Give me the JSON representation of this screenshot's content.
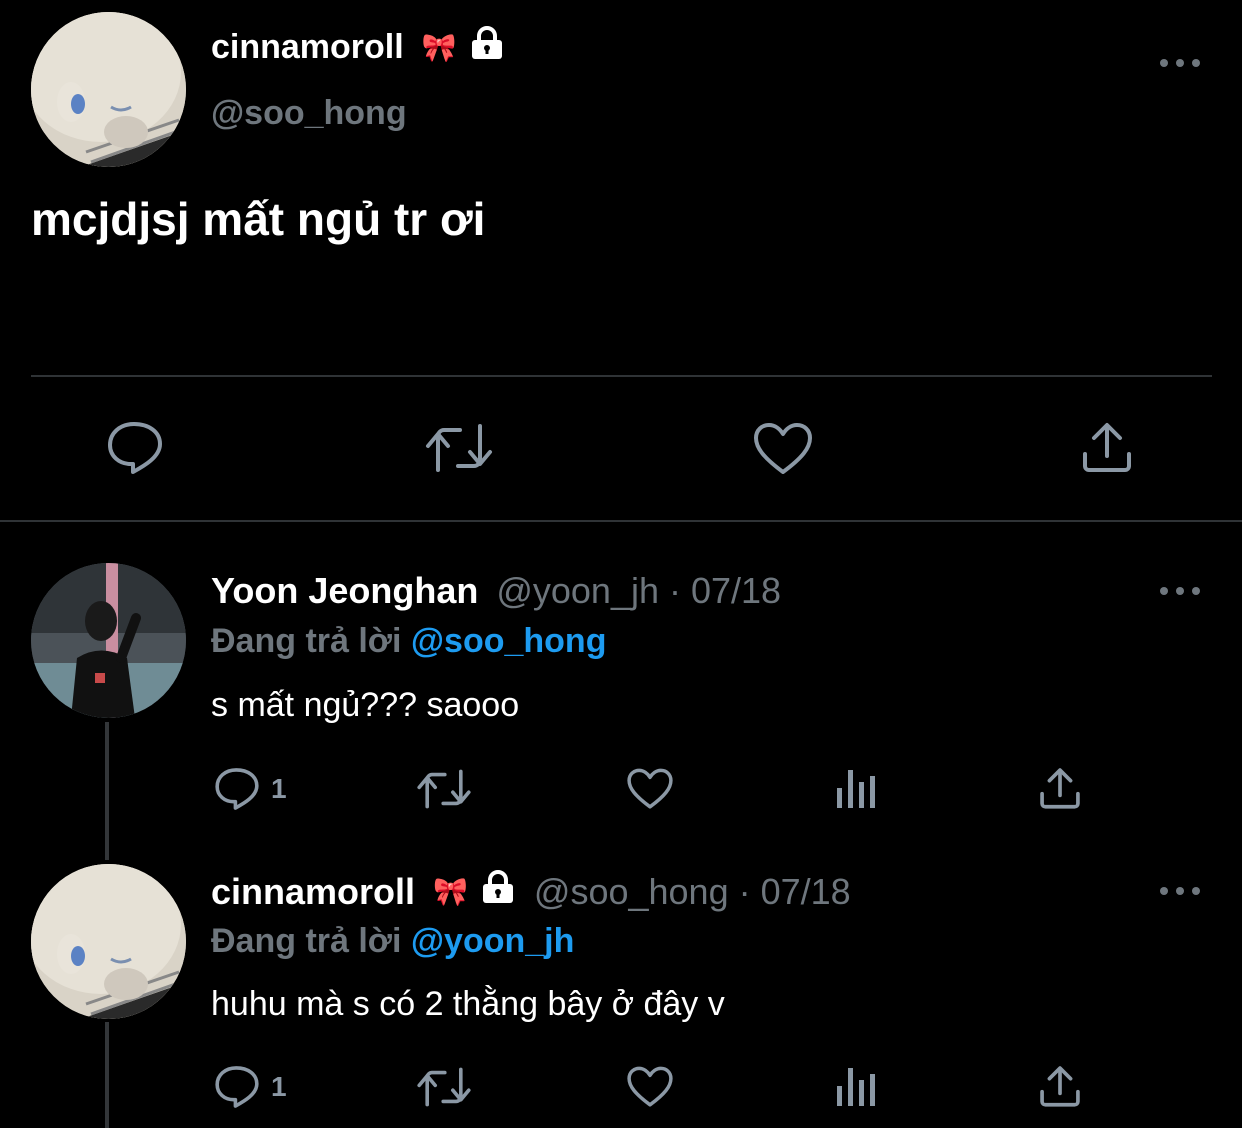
{
  "main_tweet": {
    "display_name": "cinnamoroll",
    "name_emoji": "🎀",
    "handle": "@soo_hong",
    "text": "mcjdjsj mất ngủ tr ơi"
  },
  "replies": [
    {
      "display_name": "Yoon Jeonghan",
      "handle_date": "@yoon_jh · 07/18",
      "replying_prefix": "Đang trả lời",
      "replying_to": "@soo_hong",
      "text": "s mất ngủ??? saooo",
      "reply_count": "1"
    },
    {
      "display_name": "cinnamoroll",
      "name_emoji": "🎀",
      "handle_date": "@soo_hong · 07/18",
      "replying_prefix": "Đang trả lời",
      "replying_to": "@yoon_jh",
      "text": "huhu mà s có 2 thằng bây ở đây v",
      "reply_count": "1"
    }
  ],
  "icons": {
    "reply": "reply-icon",
    "retweet": "retweet-icon",
    "like": "like-icon",
    "share": "share-icon",
    "analytics": "analytics-icon",
    "more": "more-icon",
    "lock": "lock-icon"
  },
  "colors": {
    "background": "#000000",
    "primary_text": "#ffffff",
    "secondary_text": "#6e767d",
    "mention": "#1d9bf0",
    "divider": "#2f3336"
  }
}
